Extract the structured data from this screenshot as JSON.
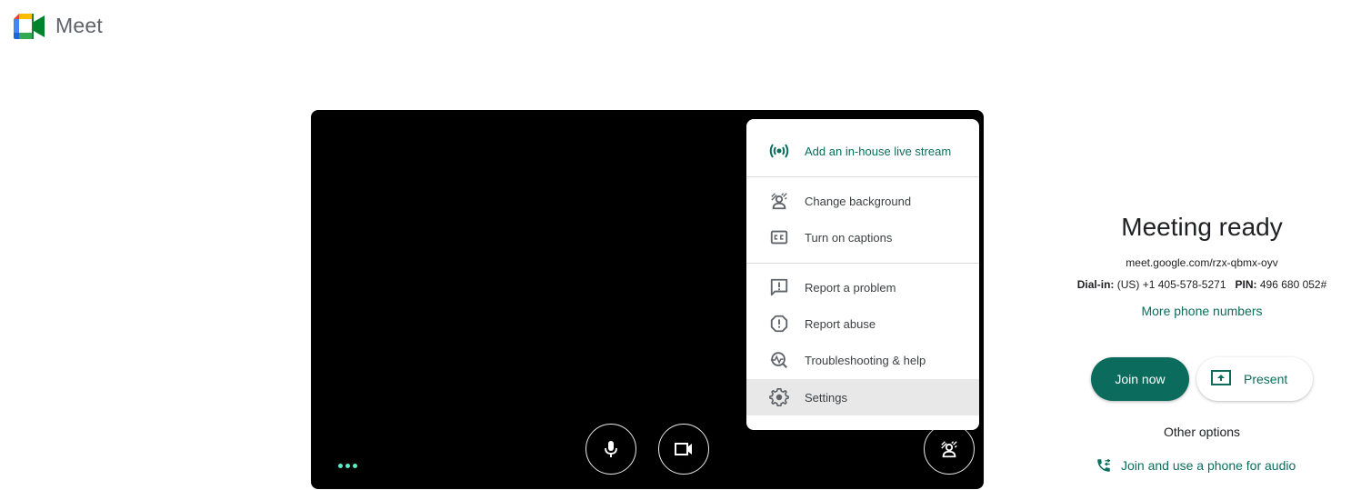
{
  "header": {
    "app_name": "Meet",
    "logo_icon": "google-meet-logo"
  },
  "video_preview": {
    "more_options_icon": "three-dots-icon",
    "controls": [
      {
        "name": "microphone",
        "icon": "mic-icon"
      },
      {
        "name": "camera",
        "icon": "videocam-icon"
      },
      {
        "name": "background-effects",
        "icon": "background-replace-icon"
      }
    ]
  },
  "menu": {
    "items": [
      {
        "label": "Add an in-house live stream",
        "icon": "live-stream-icon",
        "accent": true
      },
      {
        "label": "Change background",
        "icon": "background-replace-icon"
      },
      {
        "label": "Turn on captions",
        "icon": "closed-caption-icon"
      },
      {
        "label": "Report a problem",
        "icon": "feedback-icon"
      },
      {
        "label": "Report abuse",
        "icon": "report-icon"
      },
      {
        "label": "Troubleshooting & help",
        "icon": "troubleshoot-icon"
      },
      {
        "label": "Settings",
        "icon": "gear-icon",
        "selected": true
      }
    ]
  },
  "meeting": {
    "title": "Meeting ready",
    "url": "meet.google.com/rzx-qbmx-oyv",
    "dial_in_label": "Dial-in:",
    "dial_in_number": "(US) +1 405-578-5271",
    "pin_label": "PIN:",
    "pin_value": "496 680 052#",
    "more_phone_numbers": "More phone numbers",
    "join_now": "Join now",
    "present": "Present",
    "other_options": "Other options",
    "phone_audio": "Join and use a phone for audio"
  },
  "colors": {
    "accent": "#0b6e5d",
    "join_button": "#0b6b5c",
    "dots": "#5bebc8",
    "menu_selected": "#e8e8e8"
  }
}
